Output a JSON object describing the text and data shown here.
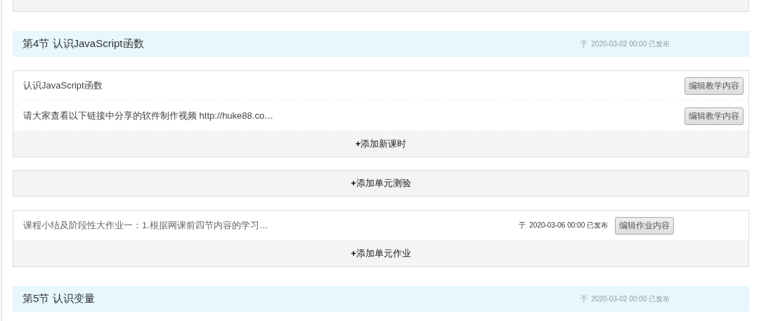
{
  "blocks": [
    {
      "kind": "add_bar"
    },
    {
      "kind": "section",
      "title": "第4节 认识JavaScript函数",
      "published": "于  2020-03-02 00:00 已发布"
    },
    {
      "kind": "lessons",
      "items": [
        {
          "title": "认识JavaScript函数",
          "button": "编辑教学内容"
        },
        {
          "title": "请大家查看以下链接中分享的软件制作视频 http://huke88.co…",
          "button": "编辑教学内容"
        }
      ],
      "add_label": "**+**添加新课时"
    },
    {
      "kind": "add_bar",
      "label": "**+**添加单元测验"
    },
    {
      "kind": "homework",
      "items": [
        {
          "title": "课程小结及阶段性大作业一：1.根据网课前四节内容的学习…",
          "published": "于  2020-03-06 00:00 已发布",
          "button": "编辑作业内容"
        }
      ],
      "add_label": "**+**添加单元作业"
    },
    {
      "kind": "section",
      "title": "第5节 认识变量",
      "published": "于  2020-03-02 00:00 已发布"
    }
  ]
}
